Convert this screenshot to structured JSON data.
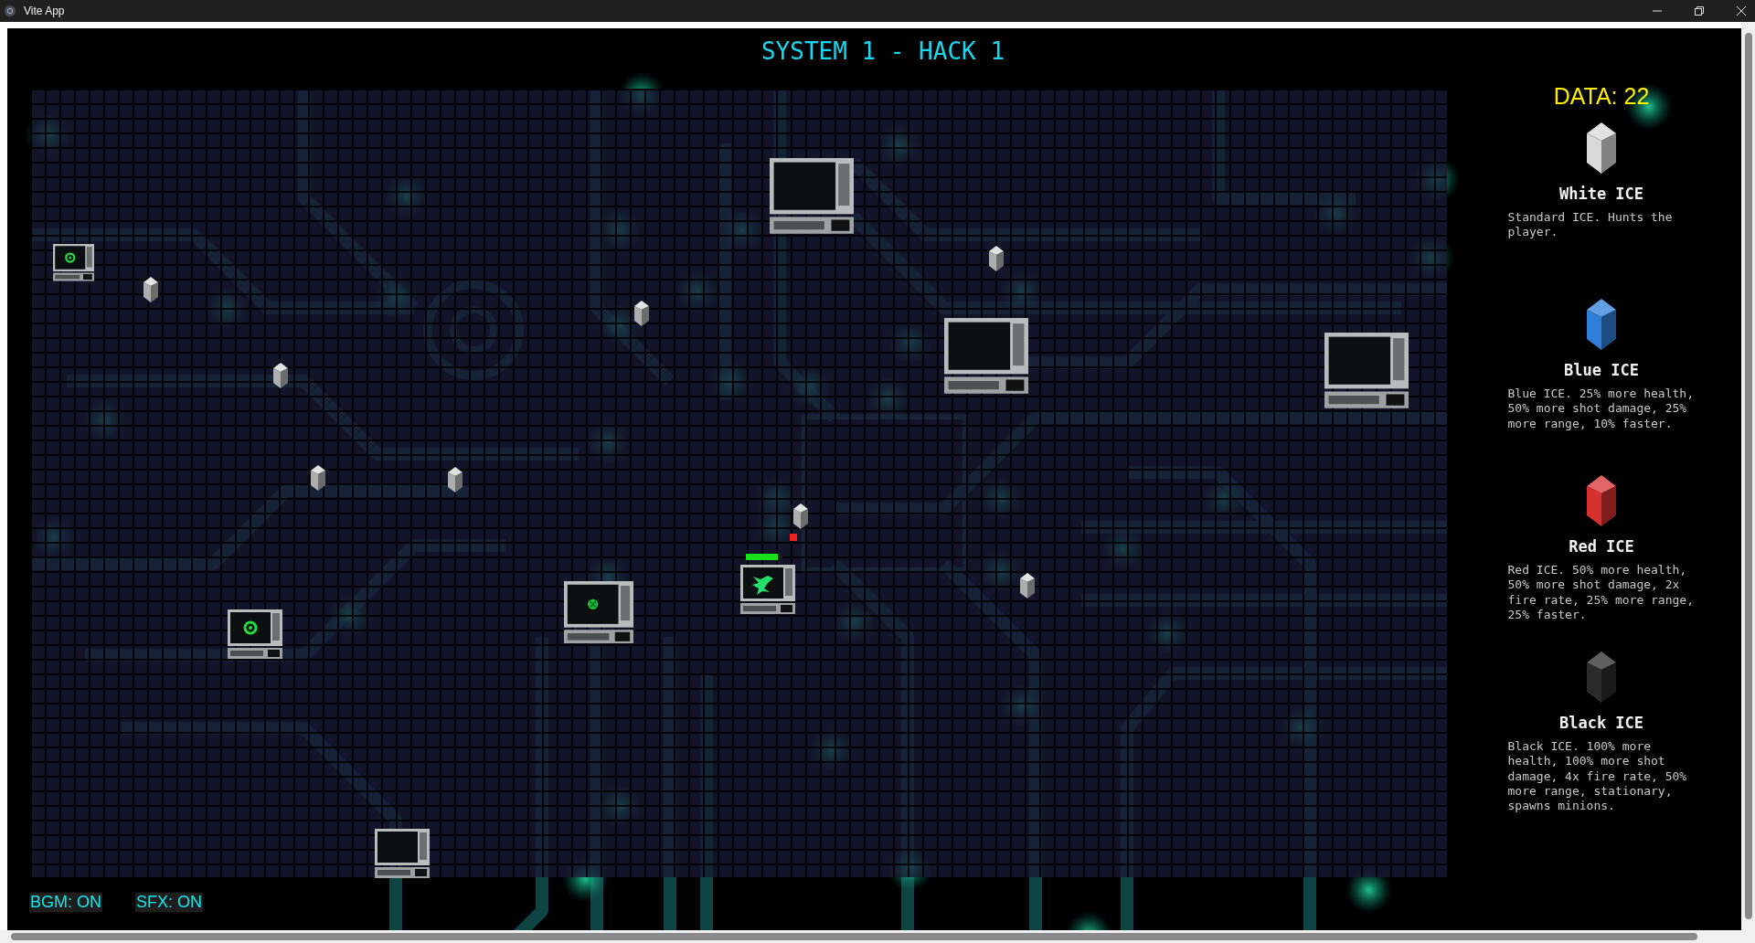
{
  "window": {
    "title": "Vite App"
  },
  "hud": {
    "title": "SYSTEM 1 - HACK 1",
    "data": "DATA: 22"
  },
  "terminals": [
    {
      "kind": "ring"
    },
    {
      "kind": "ring"
    },
    {
      "kind": "cross"
    },
    {
      "kind": "blank"
    },
    {
      "kind": "blank"
    },
    {
      "kind": "blank"
    },
    {
      "kind": "blank"
    }
  ],
  "player": {
    "kind": "virus",
    "health": {
      "level": 0.88
    }
  },
  "enemies": [
    {
      "kind": "white"
    },
    {
      "kind": "white"
    },
    {
      "kind": "white"
    },
    {
      "kind": "white"
    },
    {
      "kind": "white"
    },
    {
      "kind": "white"
    },
    {
      "kind": "white"
    },
    {
      "kind": "white"
    }
  ],
  "legend": [
    {
      "name": "White ICE",
      "color": "#d8d8d8",
      "description": "Standard ICE. Hunts the player."
    },
    {
      "name": "Blue ICE",
      "color": "#2f7fd8",
      "description": "Blue ICE. 25% more health, 50% more shot damage, 25% more range, 10% faster."
    },
    {
      "name": "Red ICE",
      "color": "#d83030",
      "description": "Red ICE. 50% more health, 50% more shot damage, 2x fire rate, 25% more range, 25% faster."
    },
    {
      "name": "Black ICE",
      "color": "#2a2a2a",
      "description": "Black ICE. 100% more health, 100% more shot damage, 4x fire rate, 50% more range, stationary, spawns minions."
    }
  ],
  "toggles": [
    {
      "label": "BGM: ON"
    },
    {
      "label": "SFX: ON"
    }
  ]
}
